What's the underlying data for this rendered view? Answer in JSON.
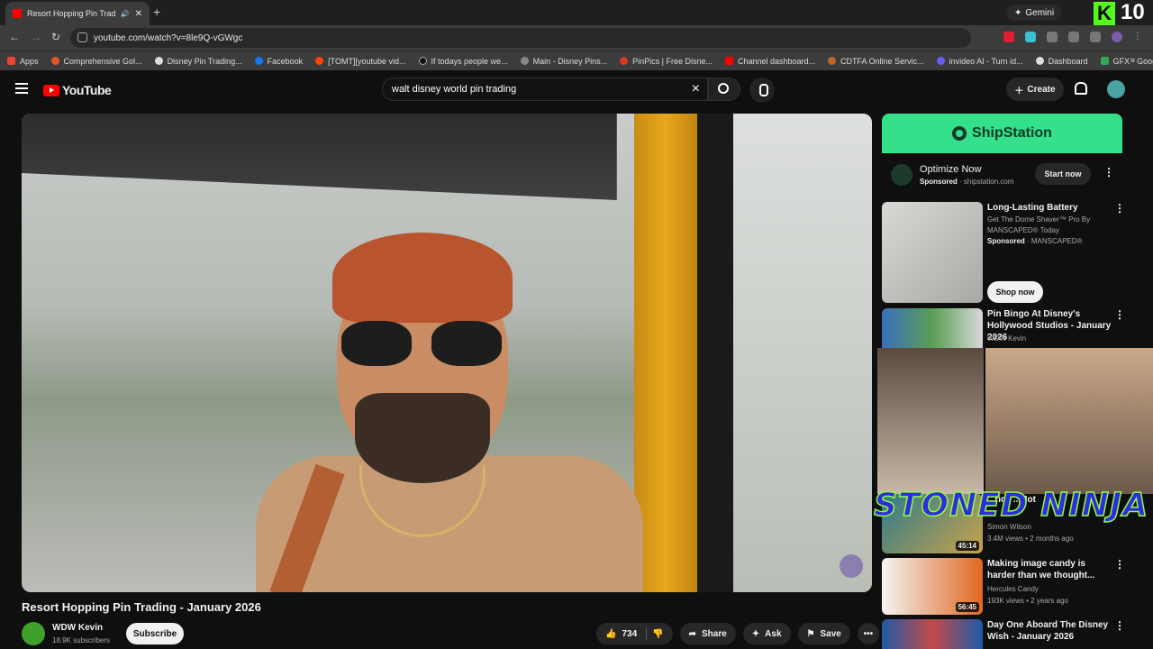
{
  "browser": {
    "tab_title": "Resort Hopping Pin Trading",
    "new_tab": "+",
    "gemini_label": "Gemini",
    "url": "youtube.com/watch?v=8le9Q-vGWgc",
    "kick_number": "10",
    "bookmarks": [
      {
        "label": "Apps",
        "color": "#ea4335"
      },
      {
        "label": "Comprehensive Gol...",
        "color": "#e05a2b"
      },
      {
        "label": "Disney Pin Trading...",
        "color": "#dddddd"
      },
      {
        "label": "Facebook",
        "color": "#1877f2"
      },
      {
        "label": "[TOMT][youtube vid...",
        "color": "#ff4500"
      },
      {
        "label": "If todays people we...",
        "color": "#111111"
      },
      {
        "label": "Main - Disney Pins...",
        "color": "#888888"
      },
      {
        "label": "PinPics | Free Disne...",
        "color": "#d73a1f"
      },
      {
        "label": "Channel dashboard...",
        "color": "#ff0000"
      },
      {
        "label": "CDTFA Online Servic...",
        "color": "#c0662b"
      },
      {
        "label": "invideo AI - Turn id...",
        "color": "#6b5cf6"
      },
      {
        "label": "Dashboard",
        "color": "#dddddd"
      },
      {
        "label": "GFX - Google Drive",
        "color": "#34a853"
      }
    ]
  },
  "youtube": {
    "logo": "YouTube",
    "search_value": "walt disney world pin trading",
    "create_label": "Create"
  },
  "video": {
    "title": "Resort Hopping Pin Trading - January 2026",
    "channel": "WDW Kevin",
    "subscribers": "18.9K subscribers",
    "subscribe_label": "Subscribe",
    "likes": "734",
    "share_label": "Share",
    "ask_label": "Ask",
    "save_label": "Save"
  },
  "ad": {
    "brand": "ShipStation",
    "title": "Optimize Now",
    "sponsored": "Sponsored",
    "domain": "shipstation.com",
    "cta": "Start now"
  },
  "related": [
    {
      "title": "Long-Lasting Battery",
      "line2": "Get The Dome Shaver™ Pro By MANSCAPED® Today",
      "sponsored": "Sponsored",
      "advertiser": "MANSCAPED®",
      "cta": "Shop now"
    },
    {
      "title": "Pin Bingo At Disney's Hollywood Studios - January 2026",
      "channel": "WDW Kevin"
    },
    {
      "title": "...rica ...Hot",
      "channel": "Simon Wilson",
      "meta": "3.4M views • 2 months ago",
      "duration": "45:14"
    },
    {
      "title": "Making image candy is harder than we thought...",
      "channel": "Hercules Candy",
      "meta": "193K views • 2 years ago",
      "duration": "56:45"
    },
    {
      "title": "Day One Aboard The Disney Wish - January 2026"
    }
  ],
  "overlay_text": "STONED NINJA"
}
